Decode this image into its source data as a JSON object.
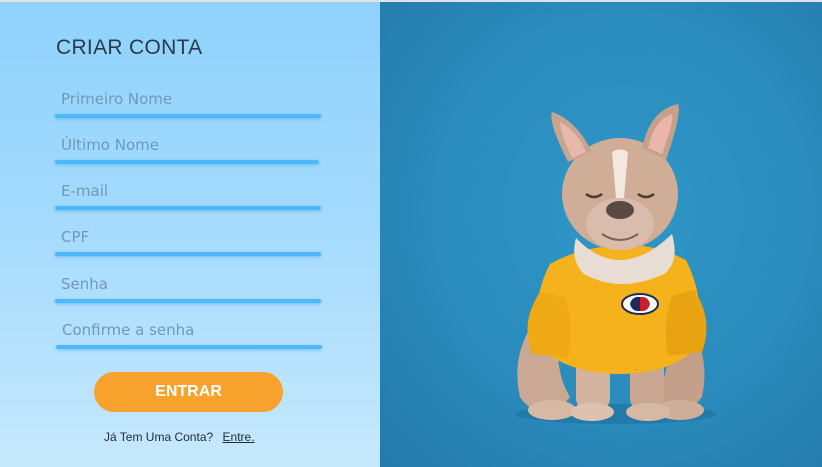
{
  "form": {
    "title": "CRIAR CONTA",
    "fields": [
      {
        "placeholder": "Primeiro Nome"
      },
      {
        "placeholder": "Último Nome"
      },
      {
        "placeholder": "E-mail"
      },
      {
        "placeholder": "CPF"
      },
      {
        "placeholder": "Senha"
      },
      {
        "placeholder": "Confirme a senha"
      }
    ],
    "submit_label": "ENTRAR",
    "footer_text": "Já Tem Uma Conta?",
    "footer_link": "Entre."
  },
  "image": {
    "subject": "french-bulldog-in-yellow-sweater",
    "background_color": "#2a8bbc",
    "sweater_color": "#f6b21c"
  },
  "colors": {
    "accent": "#4cb8f8",
    "button": "#f7a22c",
    "panel_top": "#8fd2fc",
    "panel_bottom": "#c6e8fd"
  }
}
